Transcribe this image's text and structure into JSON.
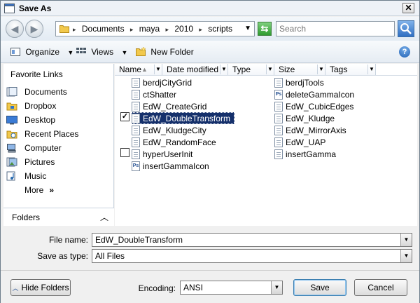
{
  "window": {
    "title": "Save As",
    "close_symbol": "✕"
  },
  "nav": {
    "back_symbol": "◀",
    "forward_symbol": "▶",
    "breadcrumbs": [
      "Documents",
      "maya",
      "2010",
      "scripts"
    ],
    "search_placeholder": "Search"
  },
  "toolbar": {
    "organize_label": "Organize",
    "views_label": "Views",
    "new_folder_label": "New Folder",
    "help_symbol": "?"
  },
  "sidebar": {
    "favorite_links_label": "Favorite Links",
    "items": [
      {
        "label": "Documents",
        "icon": "documents-icon"
      },
      {
        "label": "Dropbox",
        "icon": "dropbox-icon"
      },
      {
        "label": "Desktop",
        "icon": "desktop-icon"
      },
      {
        "label": "Recent Places",
        "icon": "recent-places-icon"
      },
      {
        "label": "Computer",
        "icon": "computer-icon"
      },
      {
        "label": "Pictures",
        "icon": "pictures-icon"
      },
      {
        "label": "Music",
        "icon": "music-icon"
      },
      {
        "label": "More",
        "icon": "more-chevron-icon"
      }
    ],
    "more_symbol": "»",
    "folders_label": "Folders",
    "folders_chevron": "︿"
  },
  "columns": [
    "Name",
    "Date modified",
    "Type",
    "Size",
    "Tags"
  ],
  "files_col1": [
    {
      "name": "berdjCityGrid",
      "type": "script",
      "selected": false,
      "checkbox": null
    },
    {
      "name": "ctShatter",
      "type": "script",
      "selected": false,
      "checkbox": null
    },
    {
      "name": "EdW_CreateGrid",
      "type": "script",
      "selected": false,
      "checkbox": null
    },
    {
      "name": "EdW_DoubleTransform",
      "type": "script",
      "selected": true,
      "checkbox": "checked"
    },
    {
      "name": "EdW_KludgeCity",
      "type": "script",
      "selected": false,
      "checkbox": null
    },
    {
      "name": "EdW_RandomFace",
      "type": "script",
      "selected": false,
      "checkbox": null
    },
    {
      "name": "hyperUserInit",
      "type": "script",
      "selected": false,
      "checkbox": "unchecked"
    },
    {
      "name": "insertGammaIcon",
      "type": "ps",
      "selected": false,
      "checkbox": null
    }
  ],
  "files_col2": [
    {
      "name": "berdjTools",
      "type": "script"
    },
    {
      "name": "deleteGammaIcon",
      "type": "ps"
    },
    {
      "name": "EdW_CubicEdges",
      "type": "script"
    },
    {
      "name": "EdW_Kludge",
      "type": "script"
    },
    {
      "name": "EdW_MirrorAxis",
      "type": "script"
    },
    {
      "name": "EdW_UAP",
      "type": "script"
    },
    {
      "name": "insertGamma",
      "type": "script"
    }
  ],
  "checkbox_checked_symbol": "✓",
  "form": {
    "file_name_label": "File name:",
    "file_name_value": "EdW_DoubleTransform",
    "save_type_label": "Save as type:",
    "save_type_value": "All Files",
    "encoding_label": "Encoding:",
    "encoding_value": "ANSI",
    "dropdown_symbol": "▼"
  },
  "buttons": {
    "hide_folders": "Hide Folders",
    "hide_chevron": "︿",
    "save": "Save",
    "cancel": "Cancel"
  },
  "colors": {
    "selection": "#15306b",
    "window_border": "#6d7d8b"
  }
}
